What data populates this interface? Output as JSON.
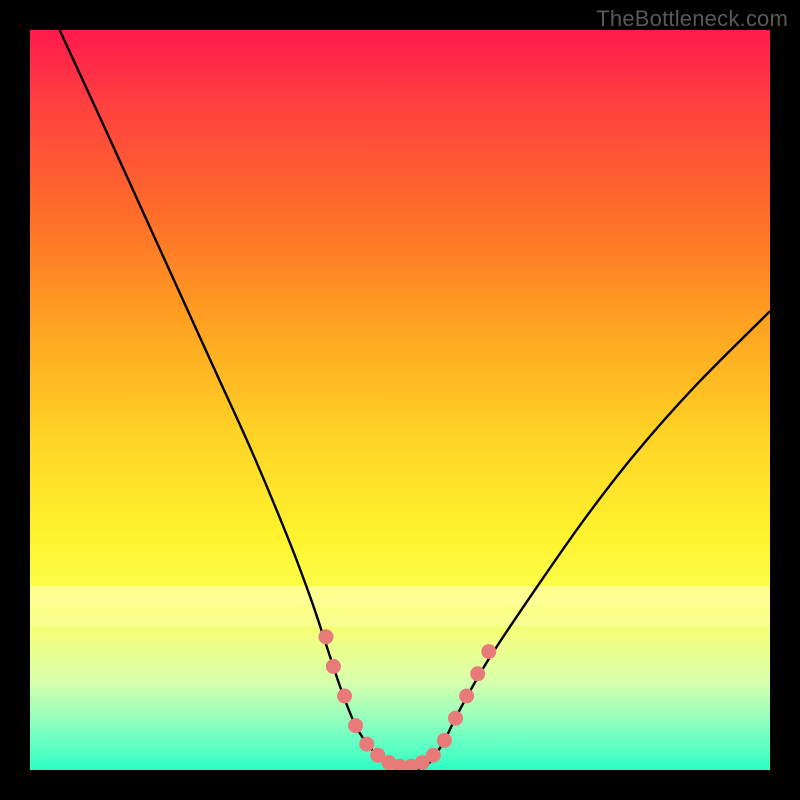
{
  "attribution": "TheBottleneck.com",
  "colors": {
    "frame": "#000000",
    "gradient_top": "#ff1a4d",
    "gradient_mid": "#ffd426",
    "gradient_bottom": "#2dffc5",
    "curve": "#000000",
    "markers": "#e87a7a"
  },
  "chart_data": {
    "type": "line",
    "title": "",
    "xlabel": "",
    "ylabel": "",
    "xlim": [
      0,
      100
    ],
    "ylim": [
      0,
      100
    ],
    "series": [
      {
        "name": "bottleneck-curve",
        "x": [
          4,
          10,
          15,
          20,
          25,
          30,
          35,
          38,
          40,
          42,
          44,
          46,
          48,
          50,
          52,
          54,
          56,
          58,
          62,
          68,
          75,
          82,
          90,
          100
        ],
        "y": [
          100,
          87,
          76,
          65,
          54,
          43,
          31,
          23,
          17,
          11,
          6,
          3,
          1,
          0,
          0,
          1,
          4,
          8,
          15,
          24,
          34,
          43,
          52,
          62
        ]
      }
    ],
    "markers": {
      "name": "highlight-points",
      "x": [
        40,
        41,
        42.5,
        44,
        45.5,
        47,
        48.5,
        50,
        51.5,
        53,
        54.5,
        56,
        57.5,
        59,
        60.5,
        62
      ],
      "y": [
        18,
        14,
        10,
        6,
        3.5,
        2,
        1,
        0.5,
        0.5,
        1,
        2,
        4,
        7,
        10,
        13,
        16
      ]
    },
    "annotations": []
  }
}
